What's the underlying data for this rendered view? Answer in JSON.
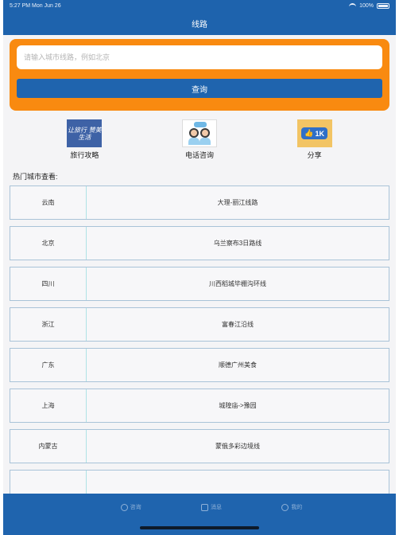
{
  "status_bar": {
    "time_date": "5:27 PM   Mon Jun 26",
    "battery": "100%"
  },
  "nav": {
    "title": "线路"
  },
  "search": {
    "placeholder": "请输入城市线路，例如北京",
    "button_label": "查询"
  },
  "shortcuts": [
    {
      "label": "旅行攻略",
      "icon": "travel-guide-icon",
      "image_text": "让旅行 赞美生活"
    },
    {
      "label": "电话咨询",
      "icon": "phone-consult-icon"
    },
    {
      "label": "分享",
      "icon": "share-thumbs-up-icon",
      "image_text": "1K"
    }
  ],
  "section_title": "热门城市查看:",
  "city_routes": [
    {
      "city": "云南",
      "route": "大理-丽江线路"
    },
    {
      "city": "北京",
      "route": "乌兰察布3日路线"
    },
    {
      "city": "四川",
      "route": "川西稻城毕棚沟环线"
    },
    {
      "city": "浙江",
      "route": "富春江沿线"
    },
    {
      "city": "广东",
      "route": "顺德广州美食"
    },
    {
      "city": "上海",
      "route": "城隍庙->豫园"
    },
    {
      "city": "内蒙古",
      "route": "蒙俄多彩边境线"
    },
    {
      "city": "",
      "route": ""
    }
  ],
  "tabbar": {
    "tabs": [
      {
        "label": "咨询",
        "icon": "consult-icon"
      },
      {
        "label": "消息",
        "icon": "message-icon"
      },
      {
        "label": "我的",
        "icon": "profile-icon"
      }
    ]
  },
  "colors": {
    "primary_blue": "#1e63ad",
    "search_orange": "#f98a10",
    "row_border": "#a9c3d8",
    "divider_cyan": "#aee3e6"
  }
}
